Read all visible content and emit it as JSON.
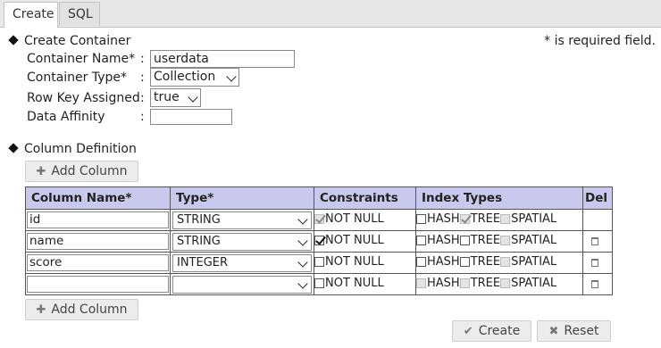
{
  "tabs": [
    {
      "label": "Create",
      "active": true
    },
    {
      "label": "SQL",
      "active": false
    }
  ],
  "create_container": {
    "heading": "Create Container",
    "required_note": "* is required field.",
    "fields": {
      "container_name": {
        "label": "Container Name*",
        "value": "userdata"
      },
      "container_type": {
        "label": "Container Type*",
        "value": "Collection"
      },
      "row_key": {
        "label": "Row Key Assigned",
        "value": "true"
      },
      "data_affinity": {
        "label": "Data Affinity",
        "value": ""
      }
    },
    "colon": ":"
  },
  "column_definition": {
    "heading": "Column Definition",
    "add_column_label": "Add Column",
    "headers": {
      "name": "Column Name*",
      "type": "Type*",
      "constraints": "Constraints",
      "index_types": "Index Types",
      "del": "Del"
    },
    "labels": {
      "not_null": "NOT NULL",
      "hash": "HASH",
      "tree": "TREE",
      "spatial": "SPATIAL"
    },
    "rows": [
      {
        "name": "id",
        "type": "STRING",
        "not_null": true,
        "not_null_disabled": true,
        "hash": false,
        "tree": true,
        "tree_disabled": true,
        "spatial_disabled": true,
        "deletable": false
      },
      {
        "name": "name",
        "type": "STRING",
        "not_null": true,
        "not_null_disabled": false,
        "hash": false,
        "tree": false,
        "tree_disabled": false,
        "spatial_disabled": true,
        "deletable": true
      },
      {
        "name": "score",
        "type": "INTEGER",
        "not_null": false,
        "not_null_disabled": false,
        "hash": false,
        "tree": false,
        "tree_disabled": false,
        "spatial_disabled": true,
        "deletable": true
      },
      {
        "name": "",
        "type": "",
        "not_null": false,
        "not_null_disabled": false,
        "hash": false,
        "hash_disabled": true,
        "tree": false,
        "tree_disabled": true,
        "spatial_disabled": true,
        "deletable": true
      }
    ]
  },
  "actions": {
    "create_label": "Create",
    "reset_label": "Reset"
  },
  "icons": {
    "section": "diamond-icon",
    "add": "plus-icon",
    "create": "check-icon",
    "reset": "x-icon",
    "delete": "trash-icon"
  },
  "colors": {
    "header_bg": "#c9c9ee",
    "tabbar_bg": "#e8e8e8"
  }
}
